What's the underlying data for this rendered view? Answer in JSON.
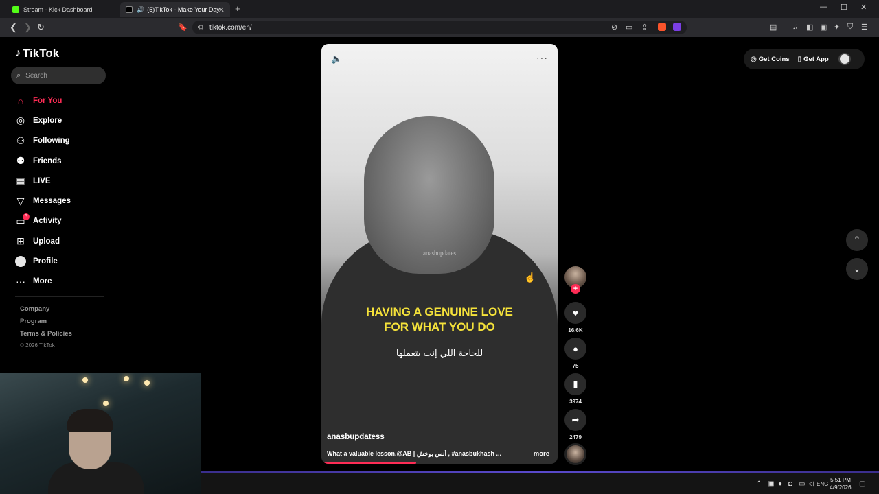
{
  "browser": {
    "tabs": [
      {
        "title": "Stream - Kick Dashboard",
        "icon": "kick-icon",
        "color": "#53fc18"
      },
      {
        "title": "(5)TikTok - Make Your Day",
        "icon": "tiktok-icon",
        "color": "#ffffff"
      }
    ],
    "url": "tiktok.com/en/"
  },
  "sidebar": {
    "brand": "TikTok",
    "search_placeholder": "Search",
    "items": [
      {
        "label": "For You",
        "icon": "home-icon",
        "active": true
      },
      {
        "label": "Explore",
        "icon": "compass-icon"
      },
      {
        "label": "Following",
        "icon": "following-icon"
      },
      {
        "label": "Friends",
        "icon": "friends-icon"
      },
      {
        "label": "LIVE",
        "icon": "live-icon"
      },
      {
        "label": "Messages",
        "icon": "messages-icon"
      },
      {
        "label": "Activity",
        "icon": "activity-icon",
        "badge": "5"
      },
      {
        "label": "Upload",
        "icon": "upload-icon"
      },
      {
        "label": "Profile",
        "icon": "profile-avatar"
      },
      {
        "label": "More",
        "icon": "more-icon"
      }
    ],
    "footer": {
      "company": "Company",
      "program": "Program",
      "terms": "Terms & Policies",
      "copyright": "© 2026 TikTok"
    }
  },
  "video": {
    "watermark": "anasbupdates",
    "caption_line1": "HAVING A GENUINE LOVE",
    "caption_line2": "FOR WHAT YOU DO",
    "caption_arabic": "للحاجة اللي إنت بتعملها",
    "author": "anasbupdatess",
    "description": "What a valuable lesson.@AB | أنس بوخش , #anasbukhash ...",
    "more_label": "more",
    "progress": 0.4
  },
  "actions": {
    "likes": "16.6K",
    "comments": "75",
    "saves": "3974",
    "shares": "2479"
  },
  "topright": {
    "get_coins": "Get Coins",
    "get_app": "Get App"
  },
  "taskbar": {
    "language": "ENG",
    "time": "5:51 PM",
    "date": "4/9/2026"
  },
  "colors": {
    "accent": "#fe2c55",
    "caption_yellow": "#f5e23a",
    "kick_green": "#53fc18"
  }
}
